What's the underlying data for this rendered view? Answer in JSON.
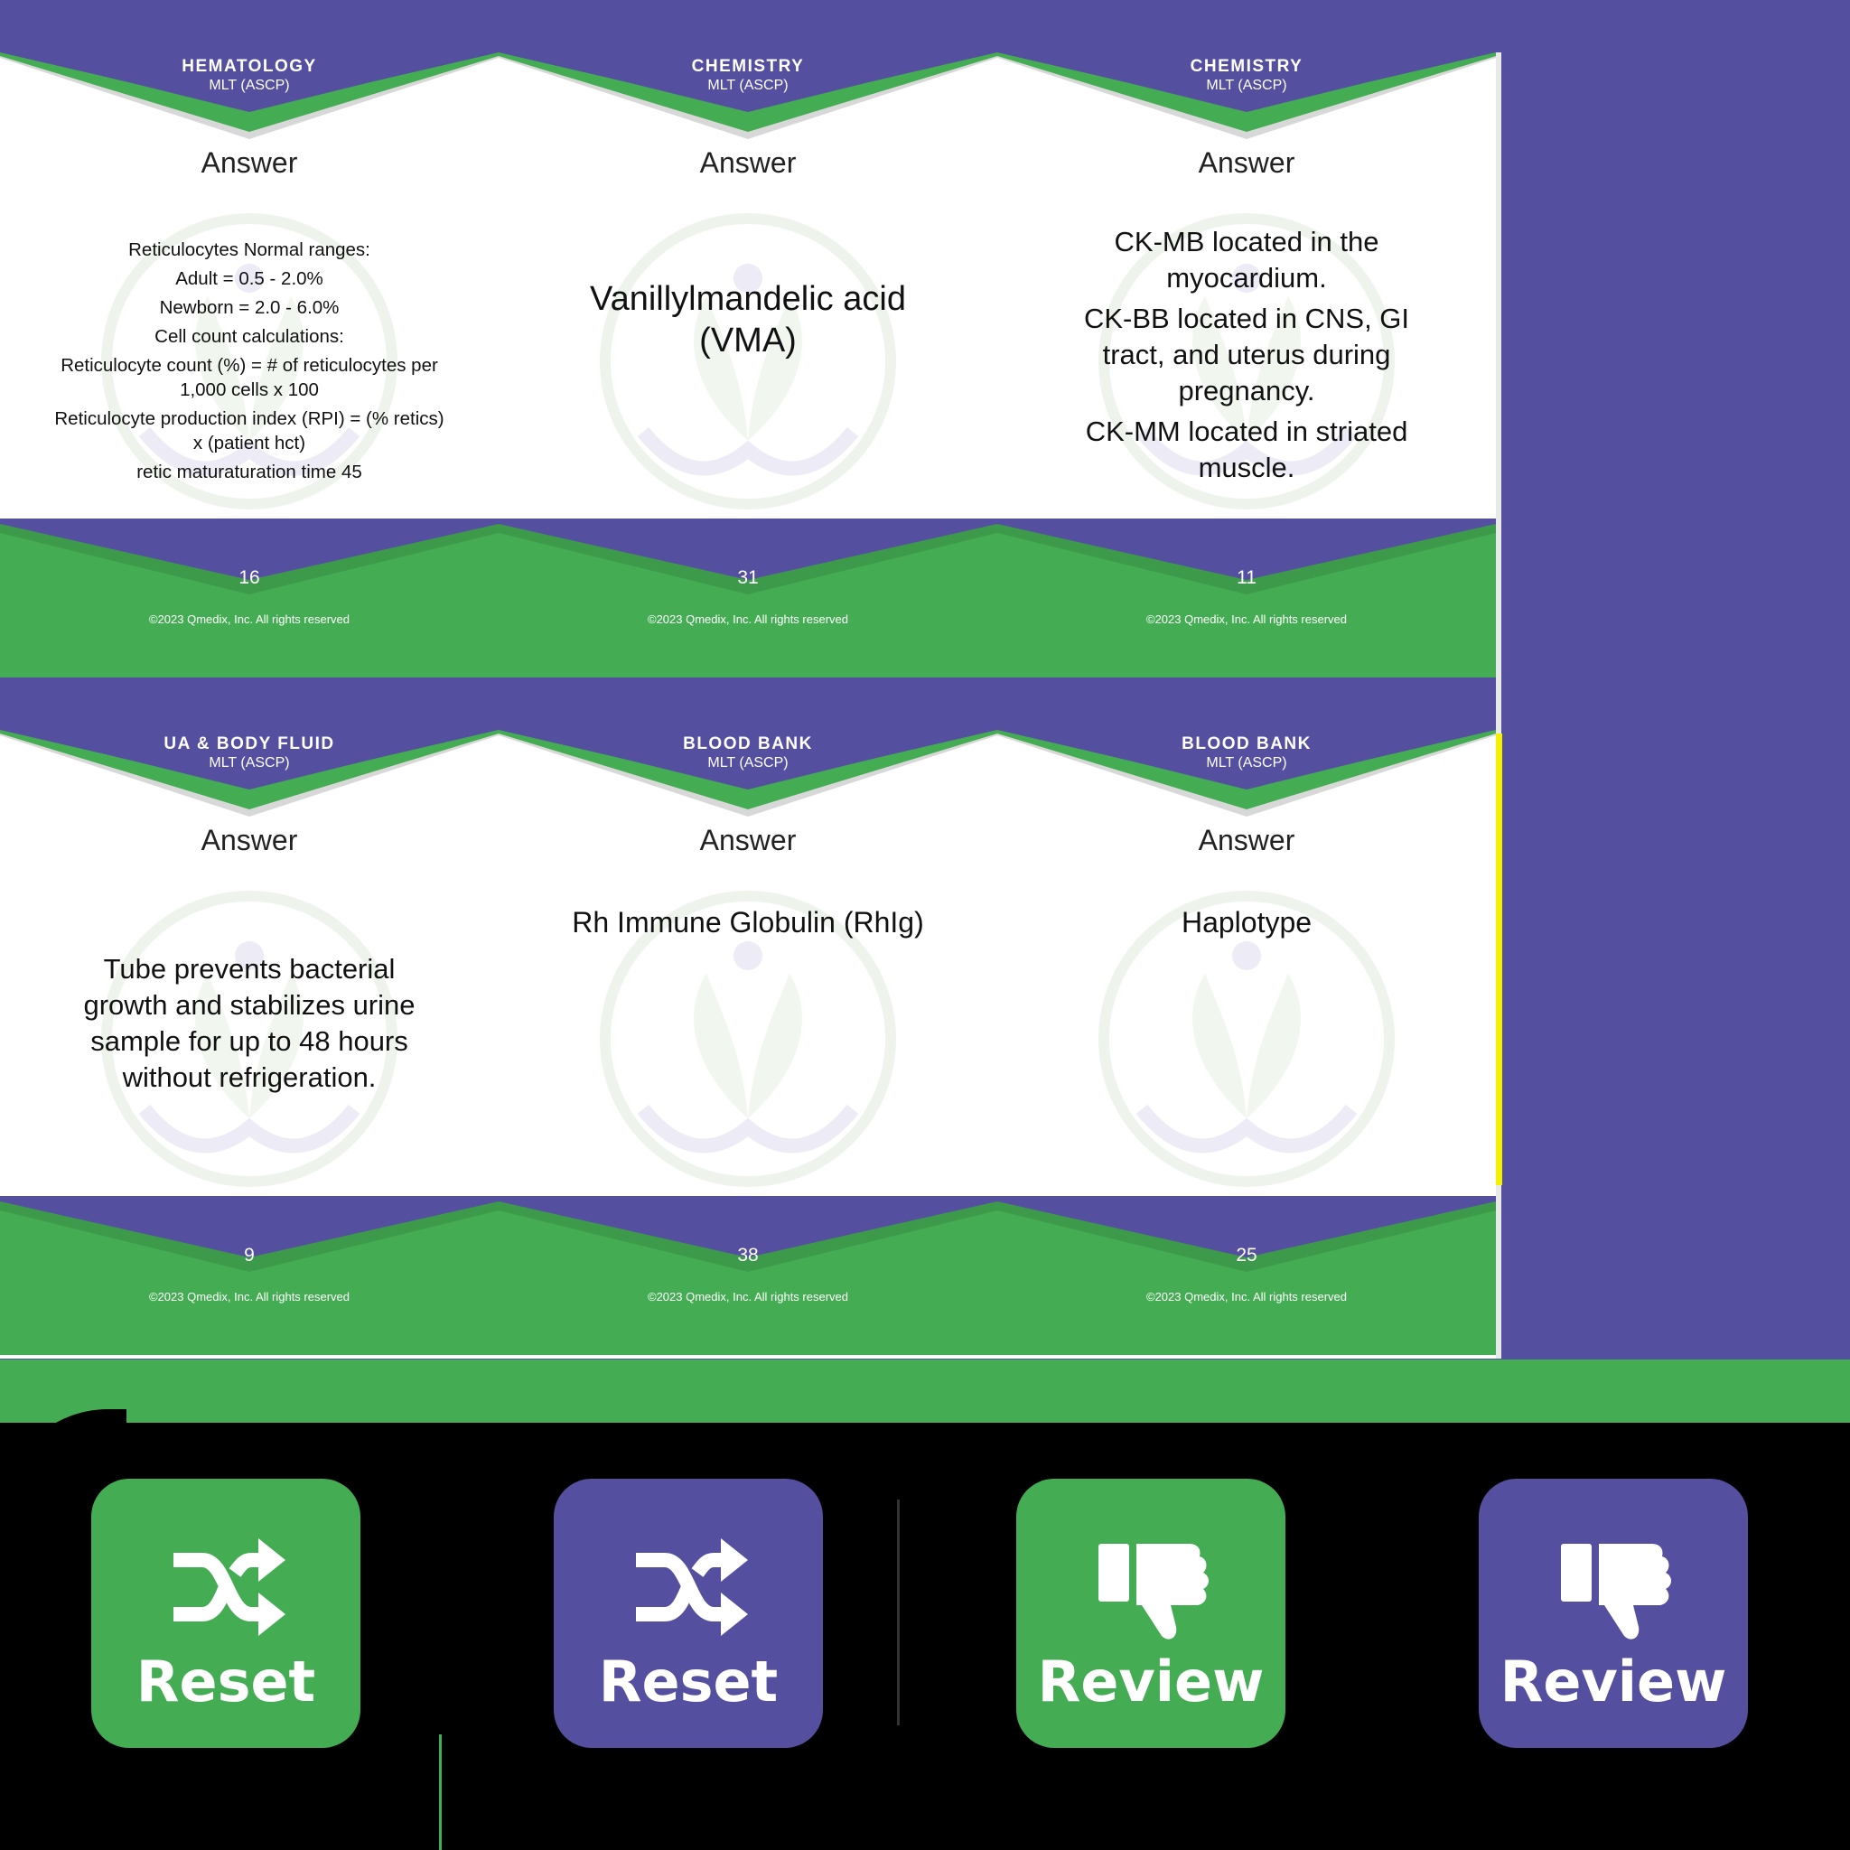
{
  "colors": {
    "purple": "#554fa0",
    "green": "#44ad53",
    "text": "#111111",
    "highlight": "#f5f200"
  },
  "cards": [
    {
      "subject": "HEMATOLOGY",
      "cert": "MLT (ASCP)",
      "answer_label": "Answer",
      "lines": [
        "Reticulocytes Normal ranges:",
        "Adult = 0.5 - 2.0%",
        "Newborn = 2.0 - 6.0%",
        "Cell count calculations:",
        "Reticulocyte count (%) = # of reticulocytes per 1,000 cells x 100",
        "Reticulocyte production index (RPI) = (% retics) x (patient hct)",
        "retic maturaturation time 45"
      ],
      "number": "16",
      "copyright": "©2023 Qmedix, Inc.  All rights reserved"
    },
    {
      "subject": "CHEMISTRY",
      "cert": "MLT (ASCP)",
      "answer_label": "Answer",
      "lines": [
        "Vanillylmandelic acid (VMA)"
      ],
      "number": "31",
      "copyright": "©2023 Qmedix, Inc.  All rights reserved"
    },
    {
      "subject": "CHEMISTRY",
      "cert": "MLT (ASCP)",
      "answer_label": "Answer",
      "lines": [
        "CK-MB located in the myocardium.",
        "CK-BB located in CNS, GI tract, and uterus during pregnancy.",
        "CK-MM located in striated muscle."
      ],
      "number": "11",
      "copyright": "©2023 Qmedix, Inc.  All rights reserved"
    },
    {
      "subject": "UA & BODY FLUID",
      "cert": "MLT (ASCP)",
      "answer_label": "Answer",
      "lines": [
        "Tube prevents bacterial growth and stabilizes urine sample for up to 48 hours without refrigeration."
      ],
      "number": "9",
      "copyright": "©2023 Qmedix, Inc.  All rights reserved"
    },
    {
      "subject": "BLOOD BANK",
      "cert": "MLT (ASCP)",
      "answer_label": "Answer",
      "lines": [
        "Rh Immune Globulin (RhIg)"
      ],
      "number": "38",
      "copyright": "©2023 Qmedix, Inc.  All rights reserved"
    },
    {
      "subject": "BLOOD BANK",
      "cert": "MLT (ASCP)",
      "answer_label": "Answer",
      "lines": [
        "Haplotype"
      ],
      "number": "25",
      "copyright": "©2023 Qmedix, Inc.  All rights reserved"
    }
  ],
  "buttons": [
    {
      "label": "Reset",
      "icon": "shuffle-icon",
      "color": "green"
    },
    {
      "label": "Reset",
      "icon": "shuffle-icon",
      "color": "purple"
    },
    {
      "label": "Review",
      "icon": "thumbs-down-icon",
      "color": "green"
    },
    {
      "label": "Review",
      "icon": "thumbs-down-icon",
      "color": "purple"
    }
  ]
}
